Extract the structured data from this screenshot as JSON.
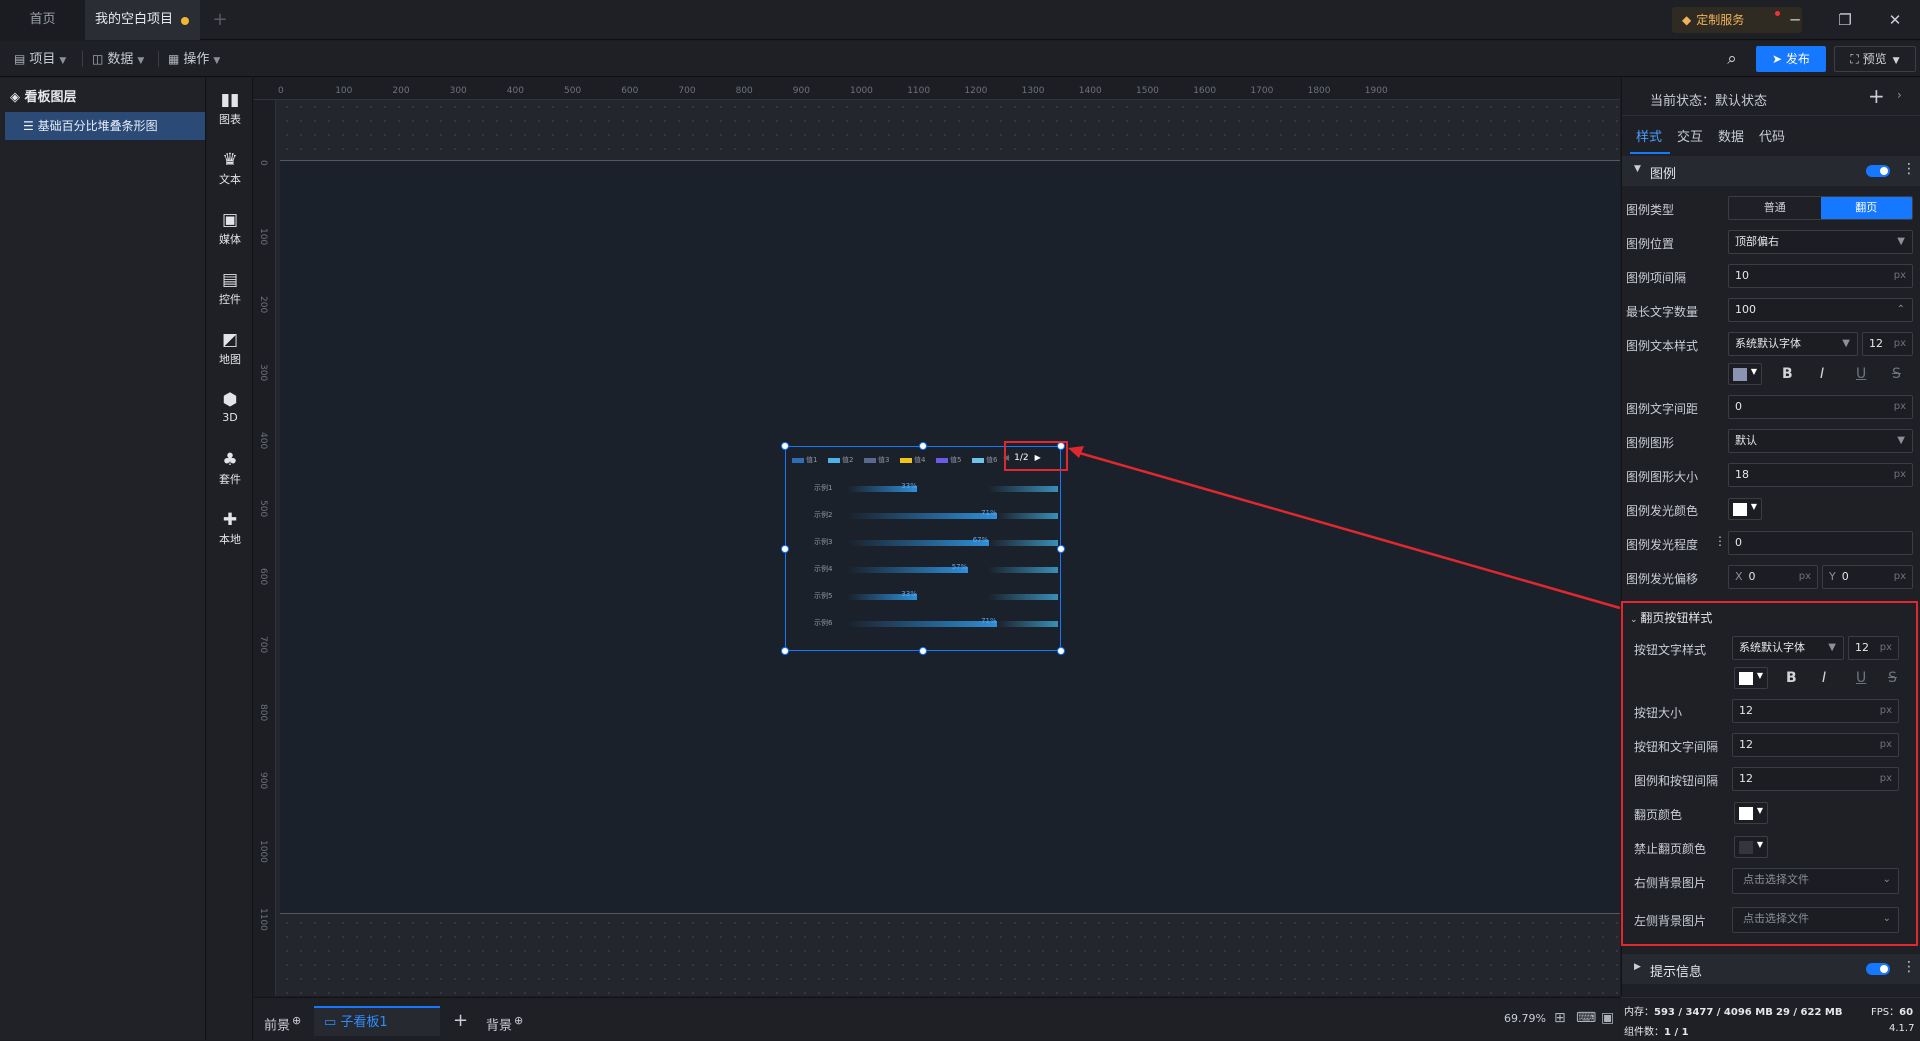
{
  "tabs": {
    "home": "首页",
    "project": "我的空白项目"
  },
  "vip": {
    "label": "定制服务"
  },
  "window": {
    "minimize": "─",
    "restore": "❐",
    "close": "✕"
  },
  "menu": {
    "project": "项目",
    "data": "数据",
    "operate": "操作",
    "publish": "发布",
    "preview": "预览"
  },
  "layers": {
    "title": "看板图层",
    "items": [
      "基础百分比堆叠条形图"
    ]
  },
  "components": [
    "图表",
    "文本",
    "媒体",
    "控件",
    "地图",
    "3D",
    "套件",
    "本地"
  ],
  "ruler": {
    "top": [
      "0",
      "100",
      "200",
      "300",
      "400",
      "500",
      "600",
      "700",
      "800",
      "900",
      "1000",
      "1100",
      "1200",
      "1300",
      "1400",
      "1500",
      "1600",
      "1700",
      "1800",
      "1900"
    ],
    "left": [
      "0",
      "100",
      "200",
      "300",
      "400",
      "500",
      "600",
      "700",
      "800",
      "900",
      "1000",
      "1100"
    ]
  },
  "chart_data": {
    "type": "bar",
    "legend": [
      "值1",
      "值2",
      "值3",
      "值4",
      "值5",
      "值6"
    ],
    "legend_colors": [
      "#2d6fb6",
      "#4db3e6",
      "#5a6a8c",
      "#f0c419",
      "#6b5be6",
      "#6fc3e8"
    ],
    "pager": "1/2",
    "categories": [
      "示例1",
      "示例2",
      "示例3",
      "示例4",
      "示例5",
      "示例6"
    ],
    "series": [
      {
        "name": "值1",
        "values": [
          33,
          71,
          67,
          57,
          33,
          71
        ]
      }
    ],
    "data_labels": [
      "33%",
      "71%",
      "67%",
      "57%",
      "33%",
      "71%"
    ],
    "xlim": [
      0,
      100
    ]
  },
  "bottom": {
    "front": "前景",
    "board": "子看板1",
    "add": "+",
    "back": "背景",
    "zoom": "69.79%"
  },
  "panel": {
    "state_label": "当前状态：",
    "state_value": "默认状态",
    "tabs": [
      "样式",
      "交互",
      "数据",
      "代码"
    ],
    "legend_section": "图例",
    "legend_type_label": "图例类型",
    "legend_type_options": [
      "普通",
      "翻页"
    ],
    "legend_type_selected": "翻页",
    "legend_pos_label": "图例位置",
    "legend_pos_value": "顶部偏右",
    "legend_gap_label": "图例项间隔",
    "legend_gap_value": "10",
    "max_text_label": "最长文字数量",
    "max_text_value": "100",
    "text_style_label": "图例文本样式",
    "font_value": "系统默认字体",
    "font_size_value": "12",
    "text_spacing_label": "图例文字间距",
    "text_spacing_value": "0",
    "shape_label": "图例图形",
    "shape_value": "默认",
    "shape_size_label": "图例图形大小",
    "shape_size_value": "18",
    "glow_color_label": "图例发光颜色",
    "glow_level_label": "图例发光程度",
    "glow_level_value": "0",
    "glow_offset_label": "图例发光偏移",
    "x_label": "X",
    "x_value": "0",
    "y_label": "Y",
    "y_value": "0",
    "unit": "px",
    "pager_section": "翻页按钮样式",
    "btn_text_style_label": "按钮文字样式",
    "btn_font_value": "系统默认字体",
    "btn_font_size_value": "12",
    "btn_size_label": "按钮大小",
    "btn_size_value": "12",
    "btn_text_gap_label": "按钮和文字间隔",
    "btn_text_gap_value": "12",
    "legend_btn_gap_label": "图例和按钮间隔",
    "legend_btn_gap_value": "12",
    "page_color_label": "翻页颜色",
    "disabled_color_label": "禁止翻页颜色",
    "right_bg_label": "右侧背景图片",
    "left_bg_label": "左侧背景图片",
    "choose_file": "点击选择文件",
    "tooltip_section": "提示信息",
    "fmt_bold": "B",
    "fmt_italic": "I",
    "fmt_underline": "U",
    "fmt_strike": "S"
  },
  "status": {
    "memory_label": "内存：",
    "memory_value": "593 / 3477 / 4096 MB",
    "gpu_value": "29 / 622 MB",
    "fps_label": "FPS：",
    "fps_value": "60",
    "comp_label": "组件数：",
    "comp_value": "1 / 1",
    "version": "4.1.7"
  },
  "colors": {
    "accent": "#1677ff",
    "highlight": "#e0282e",
    "active_layer": "#2c4a76",
    "canvas": "#1b212b"
  }
}
